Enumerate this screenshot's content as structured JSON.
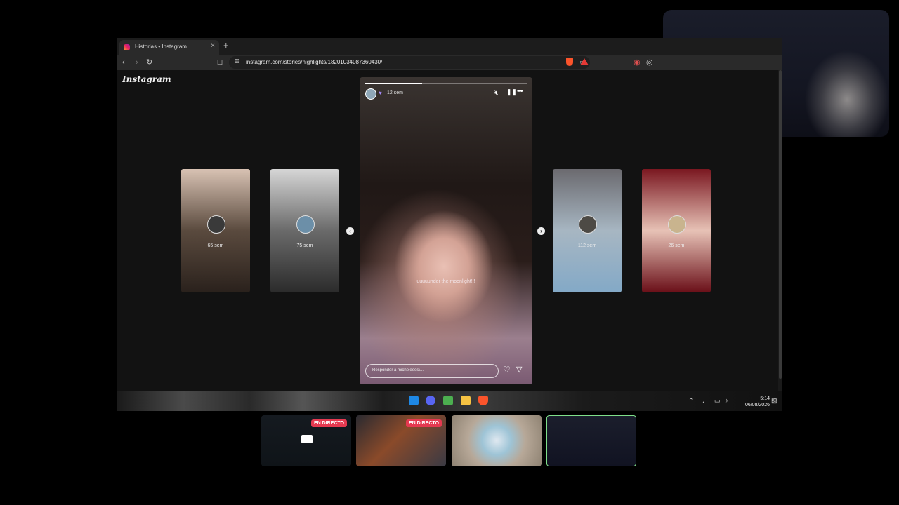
{
  "browser": {
    "tab_title": "Historias • Instagram",
    "tab_close": "×",
    "new_tab": "+",
    "url": "instagram.com/stories/highlights/18201034087360430/"
  },
  "page": {
    "logo": "Instagram"
  },
  "story": {
    "time": "12 sem",
    "caption": "uuuuunder the moonlight!!!",
    "reply_placeholder": "Responder a micheleees\\...",
    "progress": 0.35
  },
  "cards": [
    {
      "time": "65 sem",
      "colors": [
        "#d8c2b3",
        "#5a4a3e",
        "#2a211c"
      ]
    },
    {
      "time": "75 sem",
      "colors": [
        "#d6d6d6",
        "#6a6a6a",
        "#2b2b2b"
      ]
    },
    {
      "time": "112 sem",
      "colors": [
        "#6b6a6f",
        "#a7b6c2",
        "#83a9c7"
      ]
    },
    {
      "time": "26 sem",
      "colors": [
        "#7a1720",
        "#e7c2b6",
        "#6a0f18"
      ]
    }
  ],
  "taskbar": {
    "time": "5:14",
    "date": "06/08/2026"
  },
  "scenes": [
    {
      "badge": "EN DIRECTO"
    },
    {
      "badge": "EN DIRECTO"
    },
    {
      "badge": ""
    },
    {
      "badge": ""
    }
  ]
}
